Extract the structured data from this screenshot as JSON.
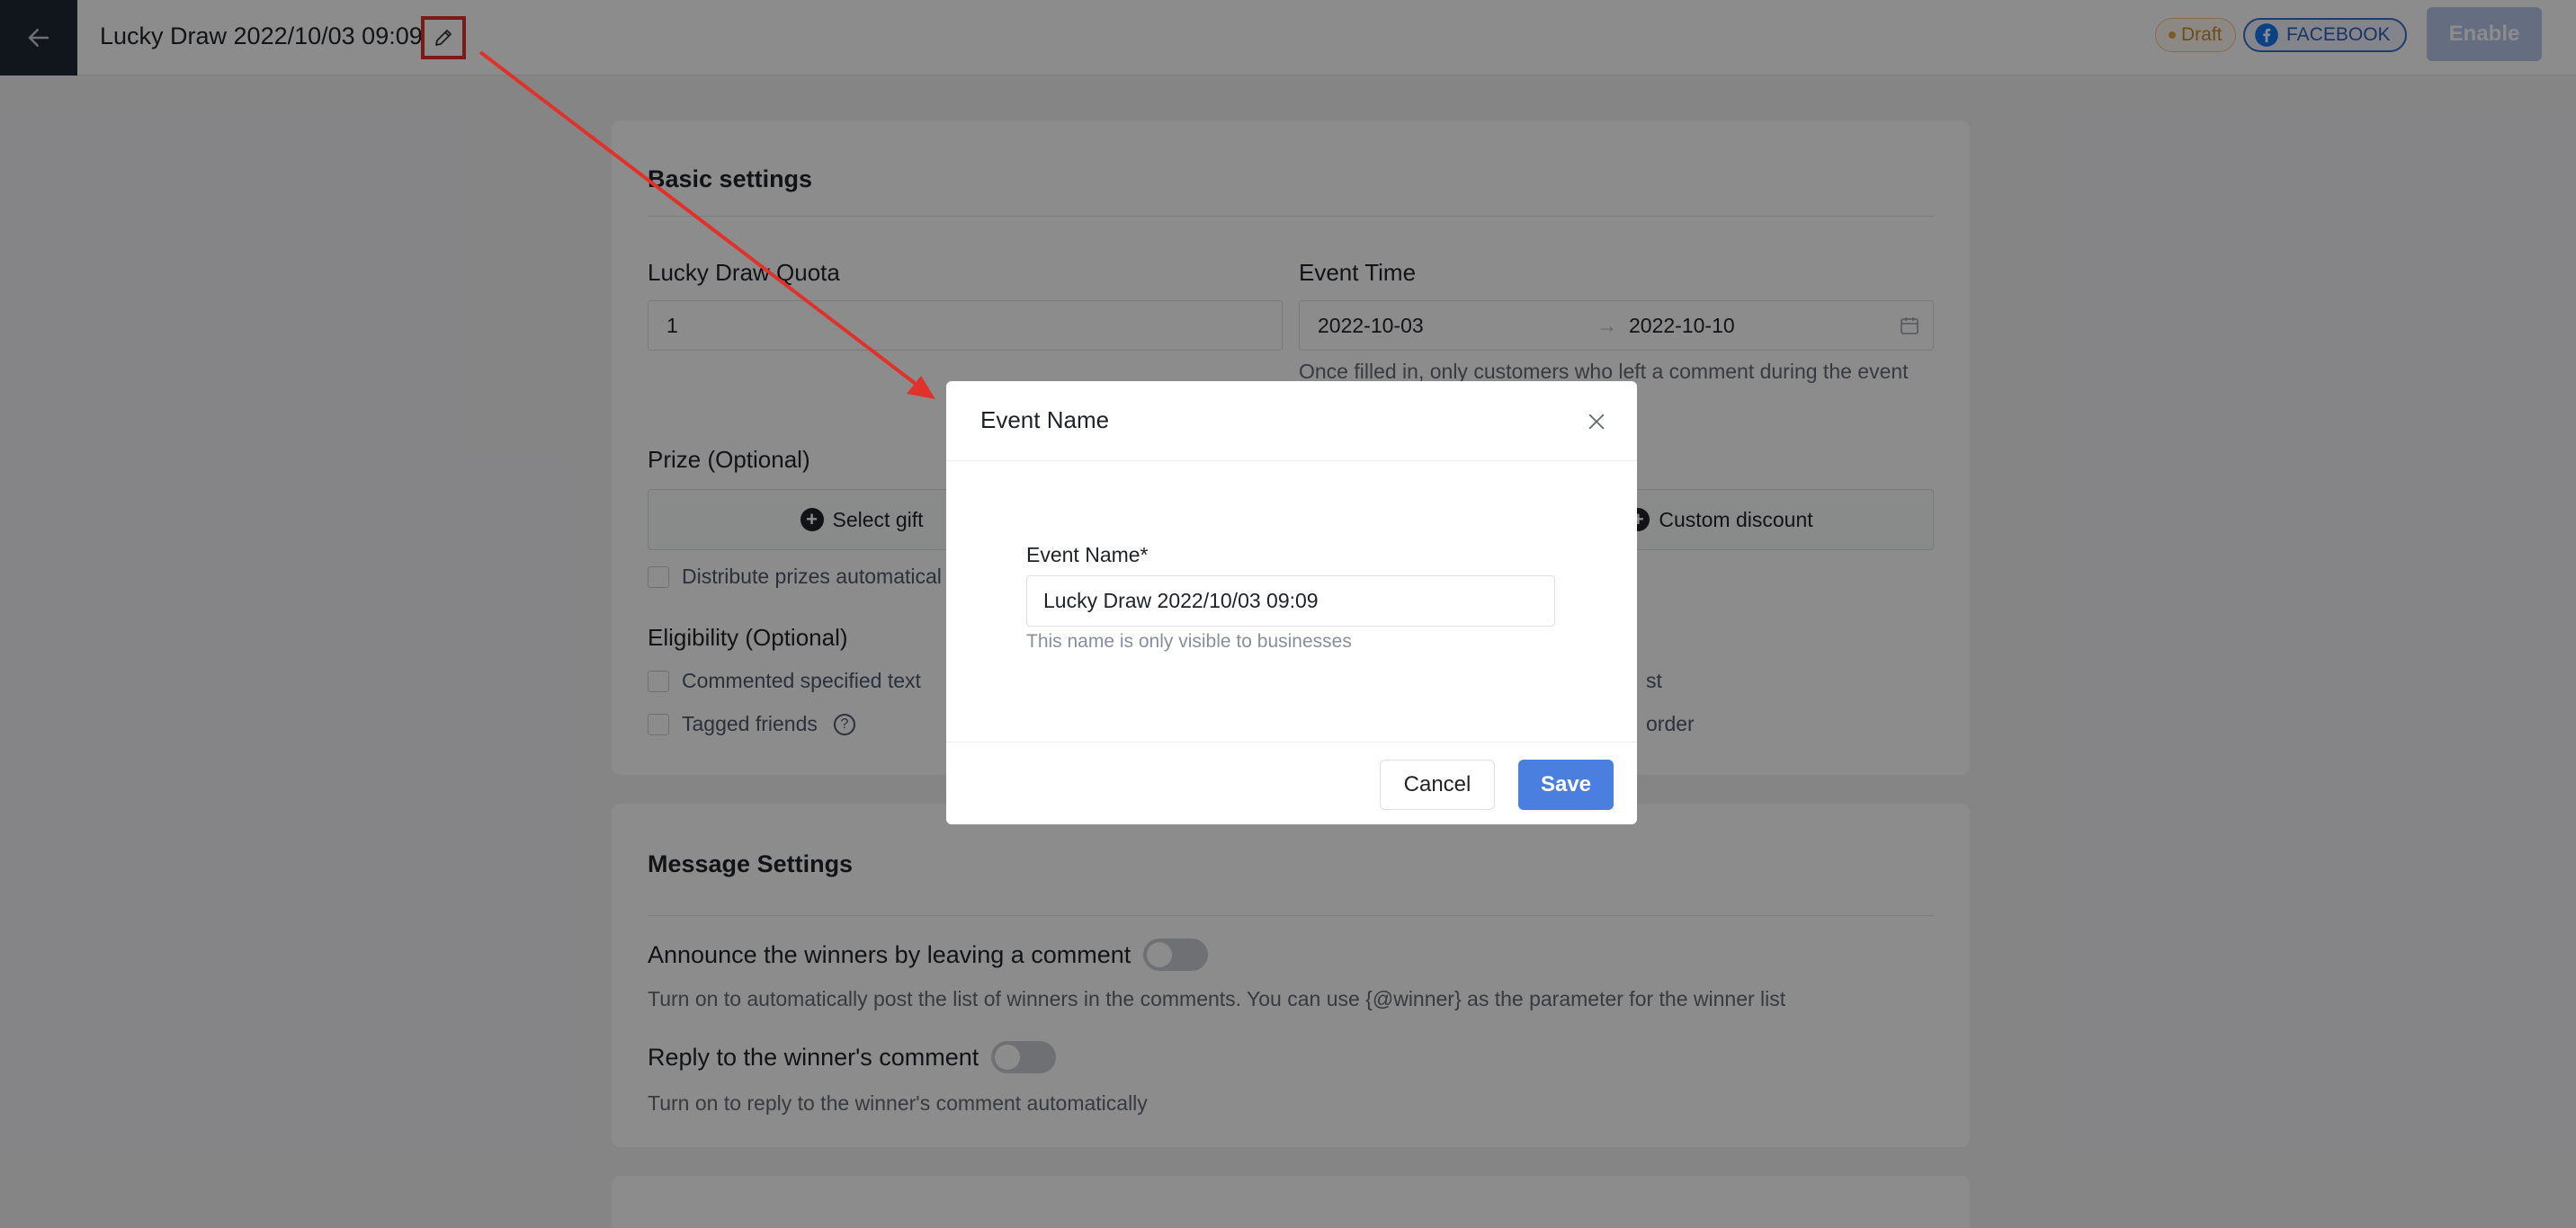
{
  "header": {
    "title": "Lucky Draw 2022/10/03 09:09",
    "status_badge": "Draft",
    "platform_badge": "FACEBOOK",
    "enable_label": "Enable"
  },
  "basic_settings": {
    "title": "Basic settings",
    "quota_label": "Lucky Draw Quota",
    "quota_value": "1",
    "event_time_label": "Event Time",
    "start_date": "2022-10-03",
    "end_date": "2022-10-10",
    "event_time_help": "Once filled in, only customers who left a comment during the event",
    "prize_label": "Prize (Optional)",
    "select_gift_label": "Select gift",
    "custom_discount_label": "Custom discount",
    "distribute_label": "Distribute prizes automatical",
    "eligibility_label": "Eligibility (Optional)",
    "commented_text_label": "Commented specified text",
    "tagged_friends_label": "Tagged friends",
    "right_option_1": "st",
    "right_option_2": "order"
  },
  "message_settings": {
    "title": "Message Settings",
    "announce_label": "Announce the winners by leaving a comment",
    "announce_help": "Turn on to automatically post the list of winners in the comments. You can use {@winner} as the parameter for the winner list",
    "reply_label": "Reply to the winner's comment",
    "reply_help": "Turn on to reply to the winner's comment automatically"
  },
  "modal": {
    "title": "Event Name",
    "field_label": "Event Name*",
    "field_value": "Lucky Draw 2022/10/03 09:09",
    "field_help": "This name is only visible to businesses",
    "cancel_label": "Cancel",
    "save_label": "Save"
  },
  "colors": {
    "annotation_red": "#e0322a",
    "primary_blue": "#4a7fe0",
    "dark_nav": "#1f2733"
  }
}
